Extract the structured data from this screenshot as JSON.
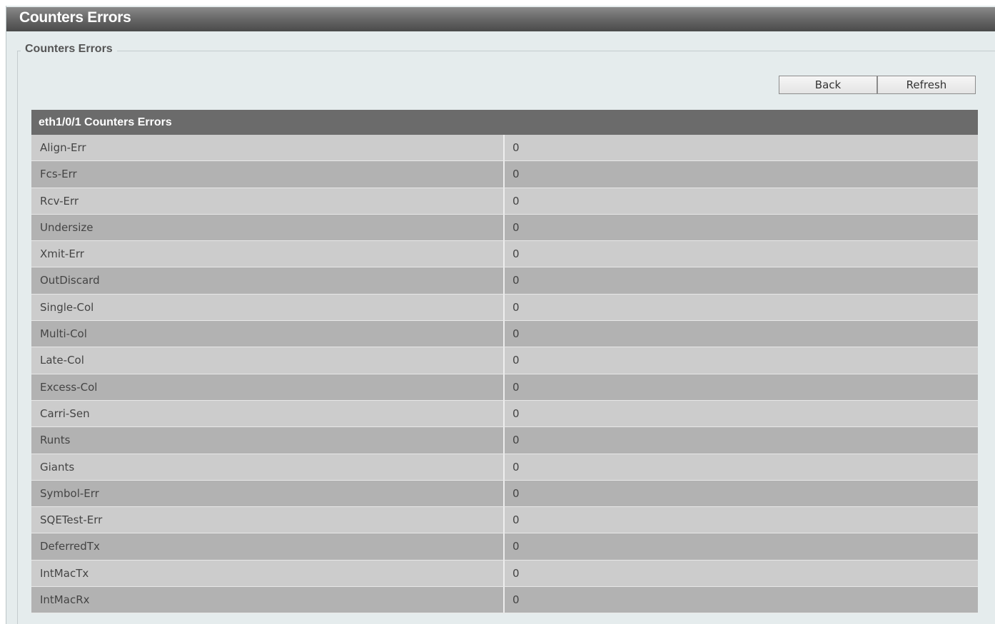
{
  "page": {
    "title": "Counters Errors",
    "section_legend": "Counters Errors"
  },
  "buttons": {
    "back_label": "Back",
    "refresh_label": "Refresh"
  },
  "table": {
    "header": "eth1/0/1 Counters Errors",
    "rows": [
      {
        "name": "Align-Err",
        "value": "0"
      },
      {
        "name": "Fcs-Err",
        "value": "0"
      },
      {
        "name": "Rcv-Err",
        "value": "0"
      },
      {
        "name": "Undersize",
        "value": "0"
      },
      {
        "name": "Xmit-Err",
        "value": "0"
      },
      {
        "name": "OutDiscard",
        "value": "0"
      },
      {
        "name": "Single-Col",
        "value": "0"
      },
      {
        "name": "Multi-Col",
        "value": "0"
      },
      {
        "name": "Late-Col",
        "value": "0"
      },
      {
        "name": "Excess-Col",
        "value": "0"
      },
      {
        "name": "Carri-Sen",
        "value": "0"
      },
      {
        "name": "Runts",
        "value": "0"
      },
      {
        "name": "Giants",
        "value": "0"
      },
      {
        "name": "Symbol-Err",
        "value": "0"
      },
      {
        "name": "SQETest-Err",
        "value": "0"
      },
      {
        "name": "DeferredTx",
        "value": "0"
      },
      {
        "name": "IntMacTx",
        "value": "0"
      },
      {
        "name": "IntMacRx",
        "value": "0"
      }
    ]
  },
  "colors": {
    "title_bar": "#6a6a6a",
    "table_header": "#6b6b6b",
    "row_light": "#cccccc",
    "row_dark": "#b2b2b2",
    "panel_bg": "#e5eced"
  }
}
